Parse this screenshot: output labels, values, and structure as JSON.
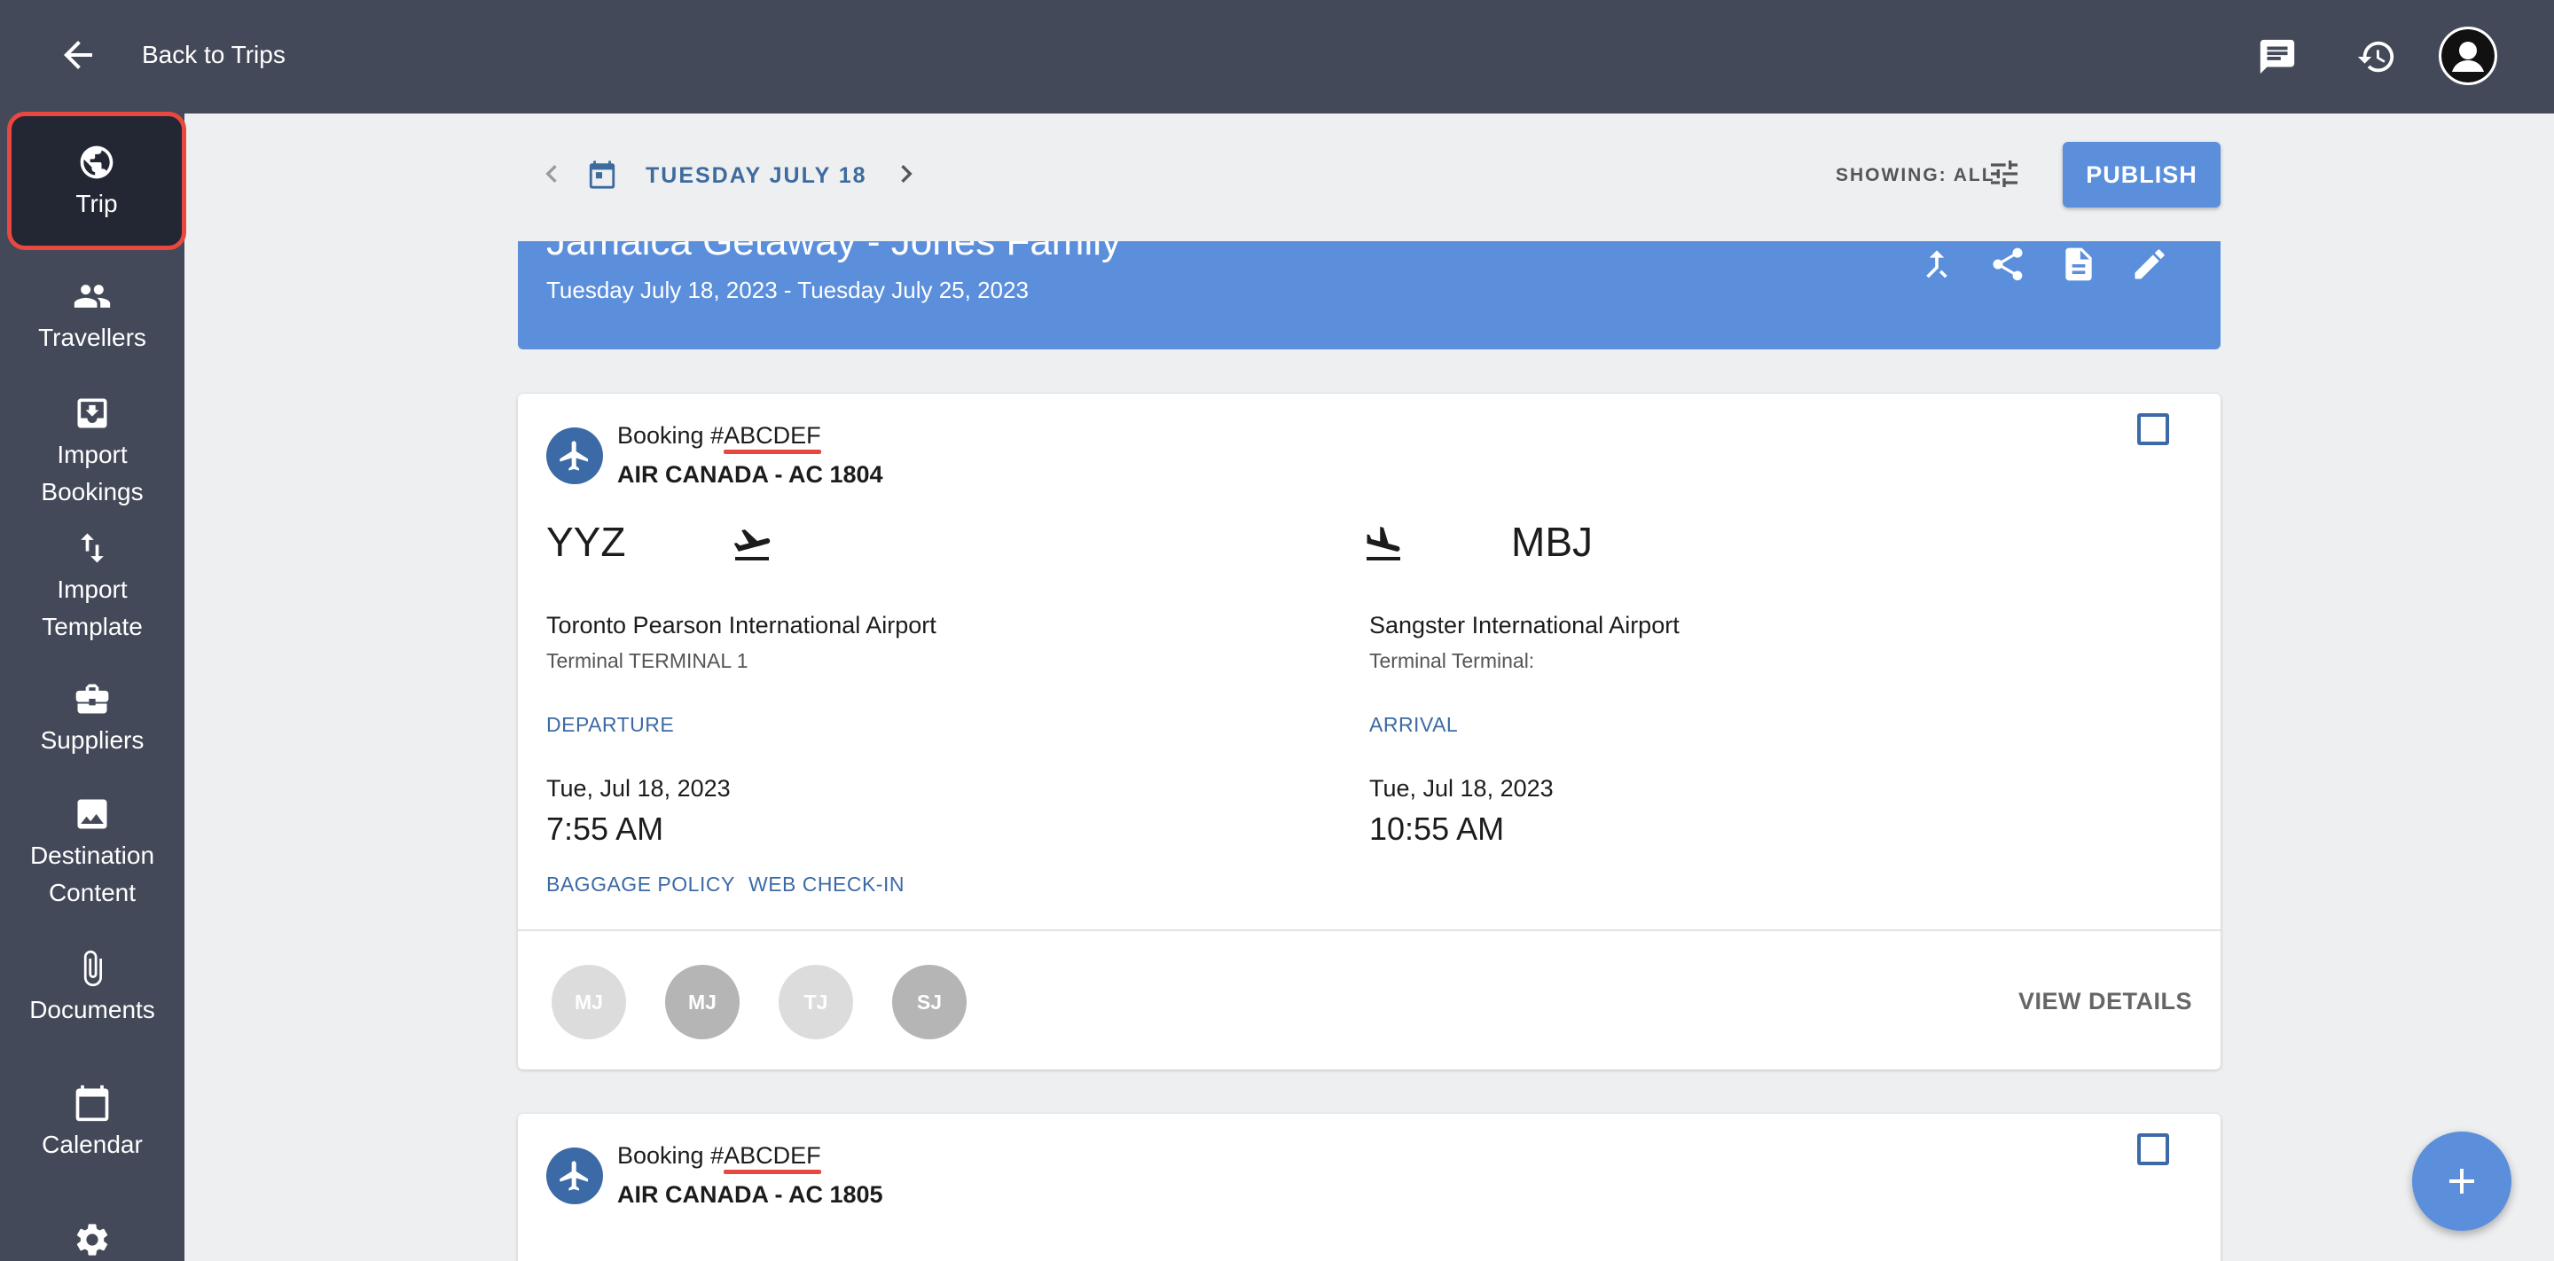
{
  "topbar": {
    "back_label": "Back to Trips",
    "icons": [
      "chat-icon",
      "history-icon",
      "user-avatar"
    ]
  },
  "sidebar": {
    "items": [
      {
        "label": "Trip",
        "icon": "globe-icon",
        "active": true
      },
      {
        "label": "Travellers",
        "icon": "people-icon"
      },
      {
        "label": "Import Bookings",
        "icon": "import-box-icon"
      },
      {
        "label": "Import Template",
        "icon": "swap-vertical-icon"
      },
      {
        "label": "Suppliers",
        "icon": "briefcase-icon"
      },
      {
        "label": "Destination Content",
        "icon": "image-icon"
      },
      {
        "label": "Documents",
        "icon": "paperclip-icon"
      },
      {
        "label": "Calendar",
        "icon": "calendar-icon"
      },
      {
        "label": "",
        "icon": "gear-icon"
      }
    ]
  },
  "datebar": {
    "date": "TUESDAY JULY 18",
    "showing": "SHOWING: ALL",
    "publish_label": "PUBLISH"
  },
  "trip": {
    "title": "Jamaica Getaway - Jones Family",
    "dates": "Tuesday July 18, 2023 - Tuesday July 25, 2023"
  },
  "bookings": [
    {
      "booking_prefix": "Booking #",
      "booking_code": "ABCDEF",
      "airline": "AIR CANADA - AC 1804",
      "departure": {
        "code": "YYZ",
        "airport": "Toronto Pearson International Airport",
        "terminal": "Terminal TERMINAL 1",
        "label": "DEPARTURE",
        "date": "Tue, Jul 18, 2023",
        "time": "7:55 AM"
      },
      "arrival": {
        "code": "MBJ",
        "airport": "Sangster International Airport",
        "terminal": "Terminal Terminal:",
        "label": "ARRIVAL",
        "date": "Tue, Jul 18, 2023",
        "time": "10:55 AM"
      },
      "links": [
        "BAGGAGE POLICY",
        "WEB CHECK-IN"
      ],
      "travellers": [
        "MJ",
        "MJ",
        "TJ",
        "SJ"
      ],
      "view_details": "VIEW DETAILS"
    },
    {
      "booking_prefix": "Booking #",
      "booking_code": "ABCDEF",
      "airline": "AIR CANADA - AC 1805"
    }
  ],
  "colors": {
    "chrome": "#434958",
    "accent": "#5b8fdc",
    "link": "#3c6aa6",
    "highlight": "#e8483f"
  }
}
